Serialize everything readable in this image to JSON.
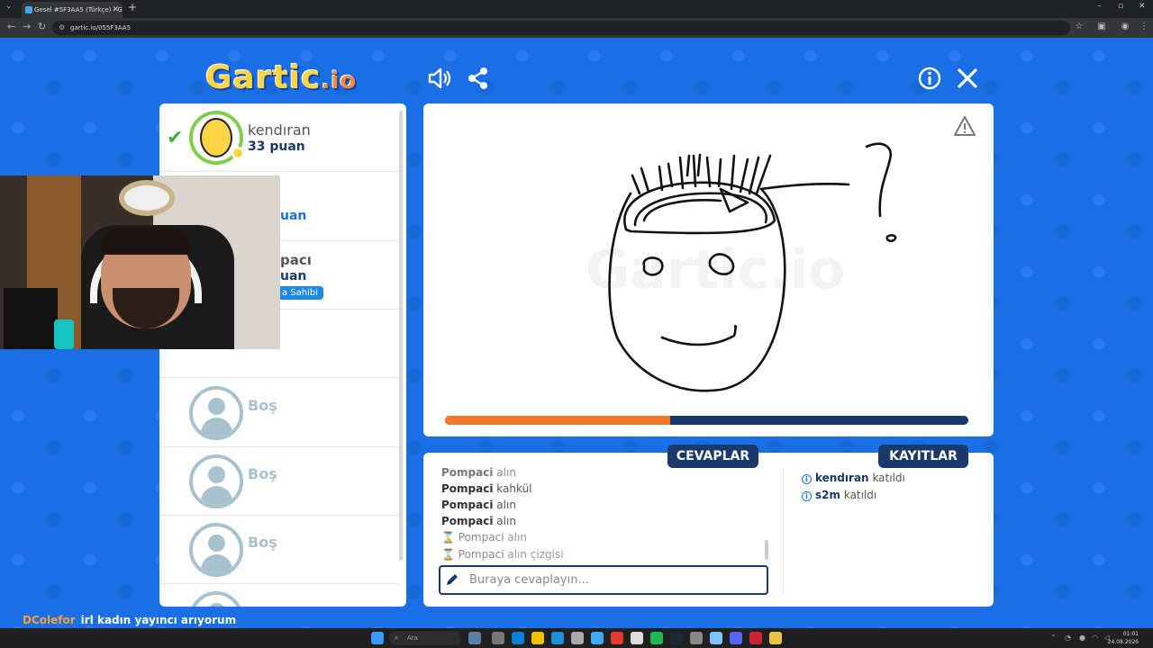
{
  "browser": {
    "tab_title": "Gesel #5F3AA5 (Türkçe) - Gartic",
    "url": "gartic.io/055F3AA5"
  },
  "logo": {
    "main": "Gartic",
    "suffix": ".io"
  },
  "players": [
    {
      "name": "kendıran",
      "points": "33 puan",
      "guessed": true
    },
    {
      "points": "uan"
    },
    {
      "name": "pacı",
      "points": "uan",
      "owner_badge": "a Sahibi"
    },
    {
      "name": "Boş"
    },
    {
      "name": "Boş"
    },
    {
      "name": "Boş"
    }
  ],
  "tabs": {
    "answers": "CEVAPLAR",
    "logs": "KAYITLAR"
  },
  "messages": [
    {
      "user": "Pompaci",
      "text": "alın",
      "faded": false
    },
    {
      "user": "Pompaci",
      "text": "kahkül",
      "faded": false
    },
    {
      "user": "Pompaci",
      "text": "alın",
      "faded": false
    },
    {
      "user": "Pompaci",
      "text": "alın",
      "faded": false
    },
    {
      "user": "Pompaci",
      "text": "alın",
      "faded": true
    },
    {
      "user": "Pompaci",
      "text": "alın çizgisi",
      "faded": true
    }
  ],
  "logs": [
    {
      "user": "kendıran",
      "text": "katıldı"
    },
    {
      "user": "s2m",
      "text": "katıldı"
    }
  ],
  "answer_input": {
    "placeholder": "Buraya cevaplayın..."
  },
  "round_progress": 0.43,
  "ticker": {
    "user": "DColefor",
    "text": "irl kadın yayıncı arıyorum"
  },
  "taskbar": {
    "search": "Ara",
    "time": "01:01",
    "date": "24.08.2026"
  },
  "colors": {
    "brand_blue": "#1a73e8",
    "dark_navy": "#1a3a6b",
    "progress_orange": "#f0782a",
    "check_green": "#3cb043"
  }
}
